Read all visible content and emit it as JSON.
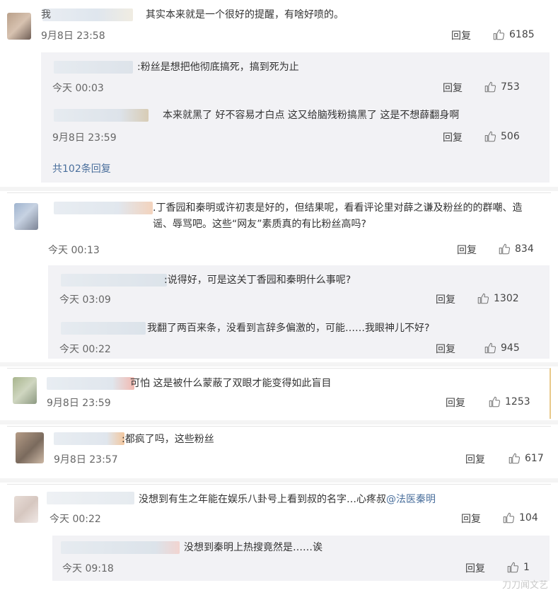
{
  "comments": [
    {
      "text": "其实本来就是一个很好的提醒，有啥好喷的。",
      "time": "9月8日 23:58",
      "reply": "回复",
      "likes": "6185",
      "name_fragment": "我",
      "replies": [
        {
          "text": ":粉丝是想把他彻底搞死，搞到死为止",
          "time": "今天 00:03",
          "reply": "回复",
          "likes": "753"
        },
        {
          "text": "本来就黑了 好不容易才白点 这又给脑残粉搞黑了 这是不想薛翻身啊",
          "time": "9月8日 23:59",
          "reply": "回复",
          "likes": "506"
        }
      ],
      "more": "共102条回复"
    },
    {
      "text": ".丁香园和秦明或许初衷是好的，但结果呢，看看评论里对薛之谦及粉丝的的群嘲、造谣、辱骂吧。这些“网友”素质真的有比粉丝高吗?",
      "time": "今天 00:13",
      "reply": "回复",
      "likes": "834",
      "replies": [
        {
          "text": ":说得好，可是这关丁香园和秦明什么事呢?",
          "time": "今天 03:09",
          "reply": "回复",
          "likes": "1302"
        },
        {
          "text": "我翻了两百来条，没看到言辞多偏激的，可能……我眼神儿不好?",
          "time": "今天 00:22",
          "reply": "回复",
          "likes": "945"
        }
      ]
    },
    {
      "text": "可怕 这是被什么蒙蔽了双眼才能变得如此盲目",
      "time": "9月8日 23:59",
      "reply": "回复",
      "likes": "1253"
    },
    {
      "text": ":都疯了吗，这些粉丝",
      "time": "9月8日 23:57",
      "reply": "回复",
      "likes": "617"
    },
    {
      "text_before": "没想到有生之年能在娱乐八卦号上看到叔的名字…心疼叔",
      "mention": "@法医秦明",
      "time": "今天 00:22",
      "reply": "回复",
      "likes": "104",
      "replies": [
        {
          "text": "没想到秦明上热搜竟然是……诶",
          "time": "今天 09:18",
          "reply": "回复",
          "likes": "1"
        }
      ]
    }
  ],
  "watermark": "刀刀闻文艺",
  "colors": {
    "link": "#4a6f9c",
    "sub_bg": "#f2f2f5",
    "text": "#333333",
    "time": "#666666"
  },
  "icons": {
    "like": "thumbs-up-icon"
  }
}
